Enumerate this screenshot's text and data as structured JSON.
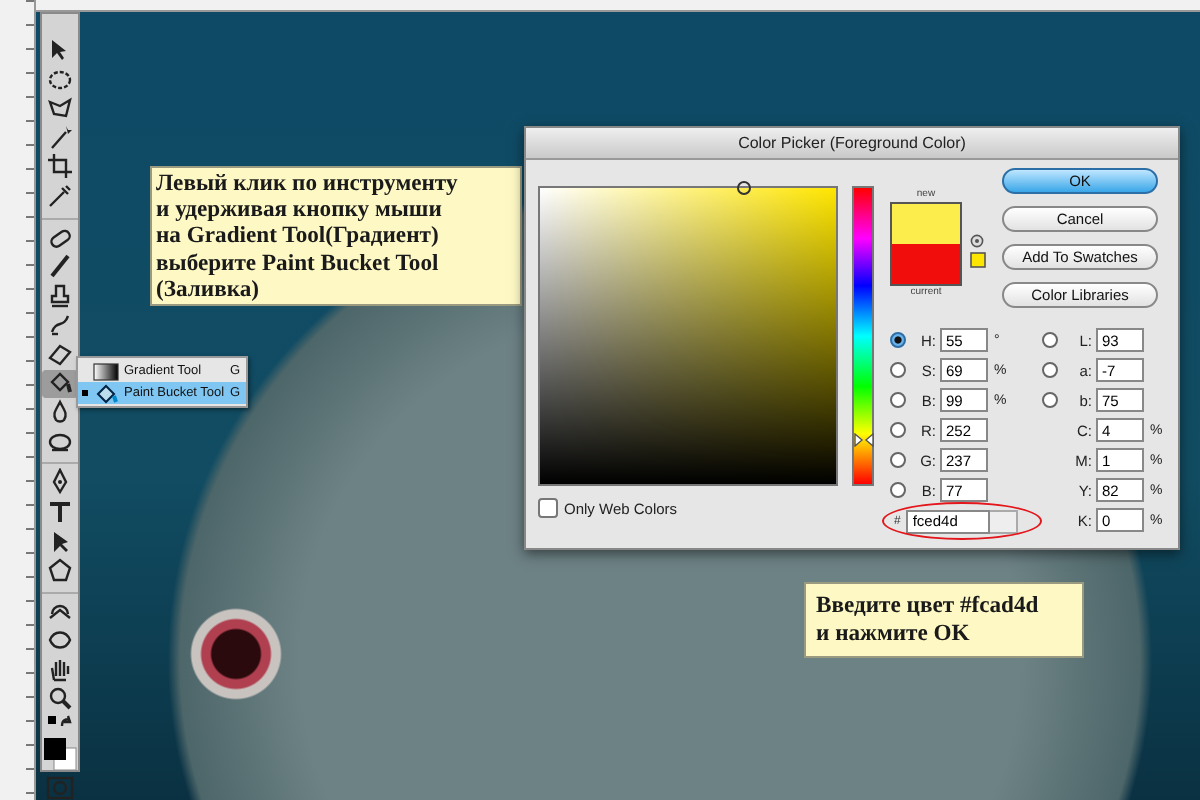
{
  "tool_flyout": {
    "items": [
      {
        "label": "Gradient Tool",
        "shortcut": "G",
        "selected": false
      },
      {
        "label": "Paint Bucket Tool",
        "shortcut": "G",
        "selected": true
      }
    ]
  },
  "callouts": [
    {
      "text": "Левый клик по инструменту\nи удерживая кнопку мыши\nна Gradient Tool(Градиент)\nвыберите Paint Bucket Tool\n(Заливка)"
    },
    {
      "text": "Введите цвет #fcad4d\n и нажмите OK"
    }
  ],
  "dialog": {
    "title": "Color Picker (Foreground Color)",
    "hue_slider": {
      "level": 0.15
    },
    "swatches": [
      {
        "label": "new",
        "color": "#fced4d"
      },
      {
        "label": "current",
        "color": "#f20d0d"
      }
    ],
    "buttons": [
      {
        "label": "OK",
        "default": true
      },
      {
        "label": "Cancel",
        "default": false
      },
      {
        "label": "Add To Swatches",
        "default": false
      },
      {
        "label": "Color Libraries",
        "default": false
      }
    ],
    "only_web_colors": {
      "label": "Only Web Colors",
      "checked": false
    },
    "fields_left": [
      {
        "kind": "radio",
        "label": "H:",
        "value": "55",
        "unit": "°",
        "selected": true
      },
      {
        "kind": "radio",
        "label": "S:",
        "value": "69",
        "unit": "%",
        "selected": false
      },
      {
        "kind": "radio",
        "label": "B:",
        "value": "99",
        "unit": "%",
        "selected": false
      },
      {
        "kind": "radio",
        "label": "R:",
        "value": "252",
        "selected": false
      },
      {
        "kind": "radio",
        "label": "G:",
        "value": "237",
        "selected": false
      },
      {
        "kind": "radio",
        "label": "B:",
        "value": "77",
        "selected": false
      }
    ],
    "fields_right": [
      {
        "kind": "radio",
        "label": "L:",
        "value": "93",
        "selected": false
      },
      {
        "kind": "radio",
        "label": "a:",
        "value": "-7",
        "selected": false
      },
      {
        "kind": "radio",
        "label": "b:",
        "value": "75",
        "selected": false
      },
      {
        "kind": "plain",
        "label": "C:",
        "value": "4",
        "unit": "%"
      },
      {
        "kind": "plain",
        "label": "M:",
        "value": "1",
        "unit": "%"
      },
      {
        "kind": "plain",
        "label": "Y:",
        "value": "82",
        "unit": "%"
      },
      {
        "kind": "plain",
        "label": "K:",
        "value": "0",
        "unit": "%"
      }
    ],
    "hex": {
      "label": "#",
      "value": "fced4d"
    }
  }
}
